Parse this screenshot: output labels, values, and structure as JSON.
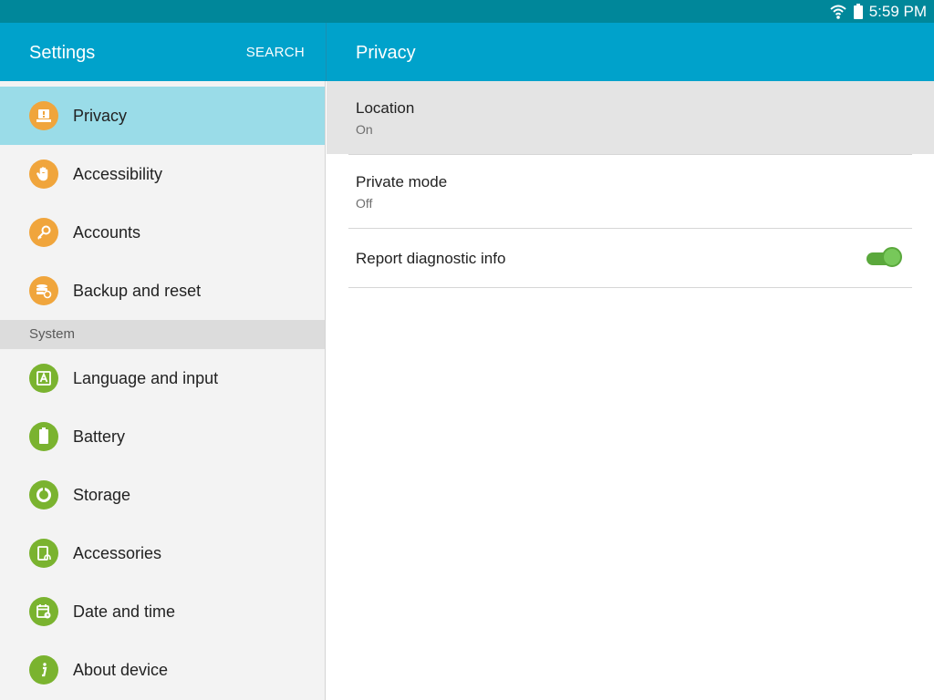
{
  "status_bar": {
    "time": "5:59 PM",
    "icons": [
      "wifi-icon",
      "battery-icon"
    ]
  },
  "header": {
    "title": "Settings",
    "search_label": "SEARCH",
    "detail_title": "Privacy"
  },
  "sidebar": {
    "items": [
      {
        "label": "Privacy",
        "icon": "privacy-icon",
        "selected": true
      },
      {
        "label": "Accessibility",
        "icon": "hand-icon"
      },
      {
        "label": "Accounts",
        "icon": "key-icon"
      },
      {
        "label": "Backup and reset",
        "icon": "backup-icon"
      }
    ],
    "section_system": "System",
    "system_items": [
      {
        "label": "Language and input",
        "icon": "language-icon"
      },
      {
        "label": "Battery",
        "icon": "battery-icon"
      },
      {
        "label": "Storage",
        "icon": "storage-icon"
      },
      {
        "label": "Accessories",
        "icon": "accessories-icon"
      },
      {
        "label": "Date and time",
        "icon": "calendar-icon"
      },
      {
        "label": "About device",
        "icon": "info-icon"
      }
    ]
  },
  "detail": {
    "rows": [
      {
        "title": "Location",
        "subtitle": "On"
      },
      {
        "title": "Private mode",
        "subtitle": "Off"
      },
      {
        "title": "Report diagnostic info",
        "toggle_on": true
      }
    ]
  },
  "colors": {
    "status_bar": "#00879a",
    "action_bar": "#00a2cb",
    "selected_item": "#9adce8",
    "orange_icon": "#f0a53c",
    "green_icon": "#7ab32f",
    "toggle_on": "#5aa83c"
  }
}
